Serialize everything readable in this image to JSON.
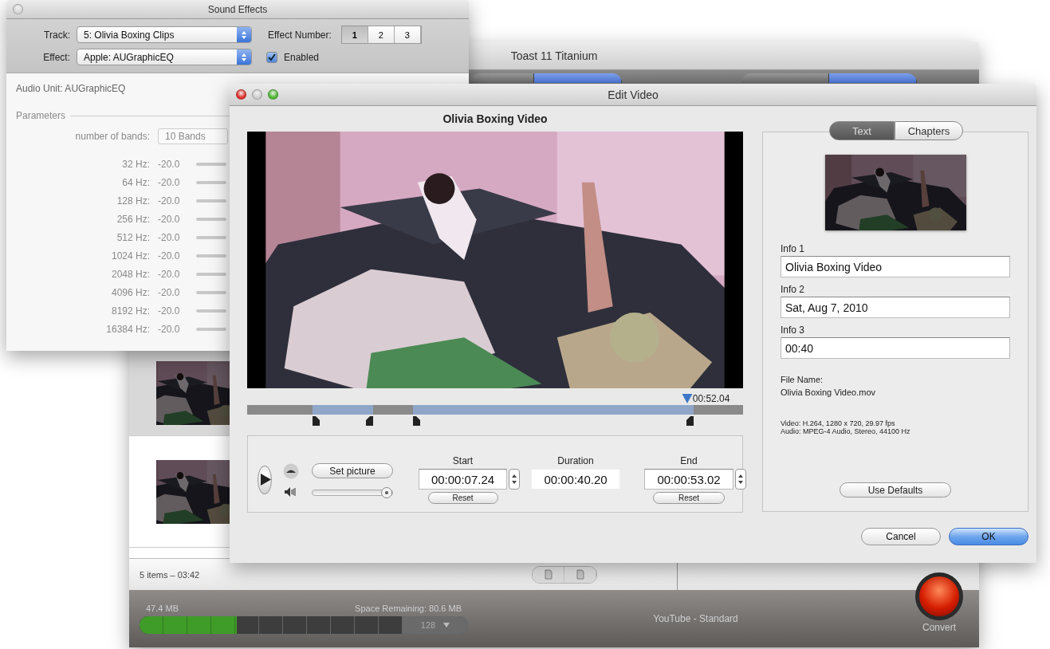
{
  "toast_window": {
    "title": "Toast 11 Titanium",
    "toolbar_segments": [
      {
        "selected": false
      },
      {
        "selected": true
      },
      {
        "selected": false
      },
      {
        "selected": true
      }
    ],
    "rows": [
      {
        "kind": "picture",
        "selected": true
      },
      {
        "kind": "picture",
        "selected": false
      }
    ],
    "summary": "5 items – 03:42",
    "capacity": {
      "used": "47.4 MB",
      "remaining": "Space Remaining: 80.6 MB",
      "level": 0.37,
      "speed": "128"
    },
    "format": "YouTube - Standard",
    "convert_label": "Convert"
  },
  "sound_effects": {
    "title": "Sound Effects",
    "track_label": "Track:",
    "track": "5: Olivia Boxing Clips",
    "effect_label": "Effect:",
    "effect": "Apple: AUGraphicEQ",
    "effect_number_label": "Effect Number:",
    "effect_numbers": [
      {
        "label": "1",
        "selected": true
      },
      {
        "label": "2",
        "selected": false
      },
      {
        "label": "3",
        "selected": false
      }
    ],
    "enabled": {
      "label": "Enabled",
      "checked": true
    },
    "audio_unit": "Audio Unit: AUGraphicEQ",
    "parameters_title": "Parameters",
    "bands_label": "number of bands:",
    "bands_value": "10 Bands",
    "bands": [
      {
        "freq": "32 Hz:",
        "value": "-20.0"
      },
      {
        "freq": "64 Hz:",
        "value": "-20.0"
      },
      {
        "freq": "128 Hz:",
        "value": "-20.0"
      },
      {
        "freq": "256 Hz:",
        "value": "-20.0"
      },
      {
        "freq": "512 Hz:",
        "value": "-20.0"
      },
      {
        "freq": "1024 Hz:",
        "value": "-20.0"
      },
      {
        "freq": "2048 Hz:",
        "value": "-20.0"
      },
      {
        "freq": "4096 Hz:",
        "value": "-20.0"
      },
      {
        "freq": "8192 Hz:",
        "value": "-20.0"
      },
      {
        "freq": "16384 Hz:",
        "value": "-20.0"
      }
    ]
  },
  "edit_video": {
    "title": "Edit Video",
    "video_title": "Olivia Boxing Video",
    "playhead": {
      "label": "00:52.04",
      "level": 0.887
    },
    "set_picture": "Set picture",
    "volume": {
      "level": 0.93
    },
    "start": {
      "label": "Start",
      "value": "00:00:07.24",
      "reset": "Reset"
    },
    "duration": {
      "label": "Duration",
      "value": "00:00:40.20"
    },
    "end": {
      "label": "End",
      "value": "00:00:53.02",
      "reset": "Reset"
    },
    "tabs": [
      {
        "label": "Text",
        "selected": true
      },
      {
        "label": "Chapters",
        "selected": false
      }
    ],
    "fields": [
      {
        "label": "Info 1",
        "value": "Olivia Boxing Video"
      },
      {
        "label": "Info 2",
        "value": "Sat, Aug 7, 2010"
      },
      {
        "label": "Info 3",
        "value": "00:40"
      }
    ],
    "file_name_label": "File Name:",
    "file_name": "Olivia Boxing Video.mov",
    "specs": [
      "Video: H.264, 1280 x 720, 29.97 fps",
      "Audio: MPEG-4 Audio, Stereo, 44100 Hz"
    ],
    "use_defaults": "Use Defaults",
    "buttons": [
      {
        "label": "Cancel",
        "kind": "normal"
      },
      {
        "label": "OK",
        "kind": "default"
      }
    ]
  }
}
